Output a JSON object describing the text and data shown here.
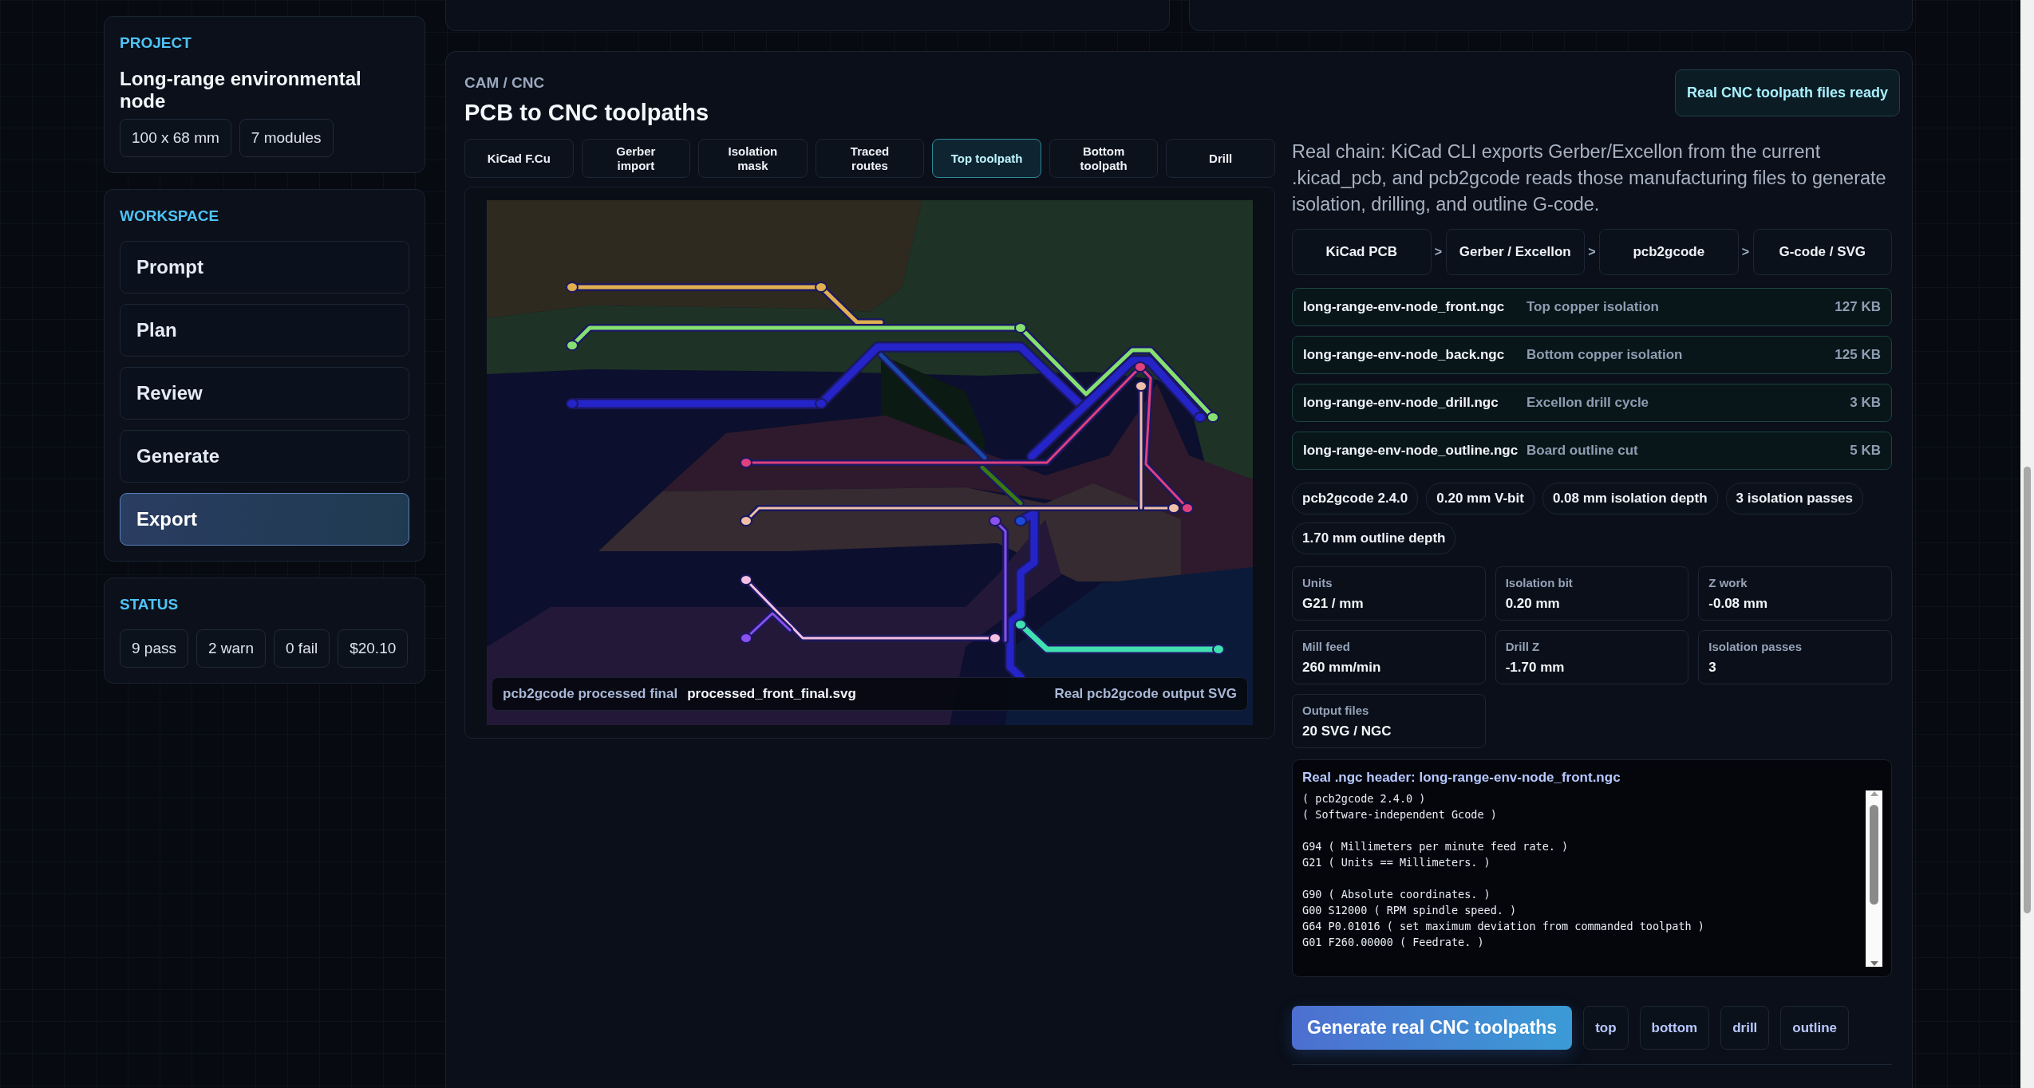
{
  "project": {
    "label": "PROJECT",
    "name": "Long-range environmental node",
    "tags": [
      "100 x 68 mm",
      "7 modules"
    ]
  },
  "workspace": {
    "label": "WORKSPACE",
    "items": [
      {
        "label": "Prompt",
        "selected": false
      },
      {
        "label": "Plan",
        "selected": false
      },
      {
        "label": "Review",
        "selected": false
      },
      {
        "label": "Generate",
        "selected": false
      },
      {
        "label": "Export",
        "selected": true
      }
    ]
  },
  "status": {
    "label": "STATUS",
    "chips": [
      "9 pass",
      "2 warn",
      "0 fail",
      "$20.10"
    ]
  },
  "cam": {
    "eyebrow": "CAM / CNC",
    "title": "PCB to CNC toolpaths",
    "badge": "Real CNC toolpath files ready",
    "tabs": [
      {
        "label": "KiCad F.Cu",
        "selected": false
      },
      {
        "label": "Gerber import",
        "selected": false
      },
      {
        "label": "Isolation mask",
        "selected": false
      },
      {
        "label": "Traced routes",
        "selected": false
      },
      {
        "label": "Top toolpath",
        "selected": true
      },
      {
        "label": "Bottom toolpath",
        "selected": false
      },
      {
        "label": "Drill",
        "selected": false
      }
    ],
    "preview": {
      "caption_label": "pcb2gcode processed final",
      "caption_file": "processed_front_final.svg",
      "caption_note": "Real pcb2gcode output SVG"
    },
    "description": "Real chain: KiCad CLI exports Gerber/Excellon from the current .kicad_pcb, and pcb2gcode reads those manufacturing files to generate isolation, drilling, and outline G-code.",
    "chain": {
      "steps": [
        "KiCad PCB",
        "Gerber / Excellon",
        "pcb2gcode",
        "G-code / SVG"
      ],
      "separators": [
        ">",
        ">",
        ">"
      ]
    },
    "files": [
      {
        "name": "long-range-env-node_front.ngc",
        "description": "Top copper isolation",
        "size": "127 KB"
      },
      {
        "name": "long-range-env-node_back.ngc",
        "description": "Bottom copper isolation",
        "size": "125 KB"
      },
      {
        "name": "long-range-env-node_drill.ngc",
        "description": "Excellon drill cycle",
        "size": "3 KB"
      },
      {
        "name": "long-range-env-node_outline.ngc",
        "description": "Board outline cut",
        "size": "5 KB"
      }
    ],
    "chips": [
      "pcb2gcode 2.4.0",
      "0.20 mm V-bit",
      "0.08 mm isolation depth",
      "3 isolation passes",
      "1.70 mm outline depth"
    ],
    "settings": [
      {
        "label": "Units",
        "value": "G21 / mm"
      },
      {
        "label": "Isolation bit",
        "value": "0.20 mm"
      },
      {
        "label": "Z work",
        "value": "-0.08 mm"
      },
      {
        "label": "Mill feed",
        "value": "260 mm/min"
      },
      {
        "label": "Drill Z",
        "value": "-1.70 mm"
      },
      {
        "label": "Isolation passes",
        "value": "3"
      },
      {
        "label": "Output files",
        "value": "20 SVG / NGC"
      }
    ],
    "code": {
      "title": "Real .ngc header: long-range-env-node_front.ngc",
      "text": "( pcb2gcode 2.4.0 )\n( Software-independent Gcode )\n\nG94 ( Millimeters per minute feed rate. )\nG21 ( Units == Millimeters. )\n\nG90 ( Absolute coordinates. )\nG00 S12000 ( RPM spindle speed. )\nG64 P0.01016 ( set maximum deviation from commanded toolpath )\nG01 F260.00000 ( Feedrate. )"
    },
    "actions": {
      "primary": "Generate real CNC toolpaths",
      "secondary": [
        "top",
        "bottom",
        "drill",
        "outline"
      ]
    }
  }
}
